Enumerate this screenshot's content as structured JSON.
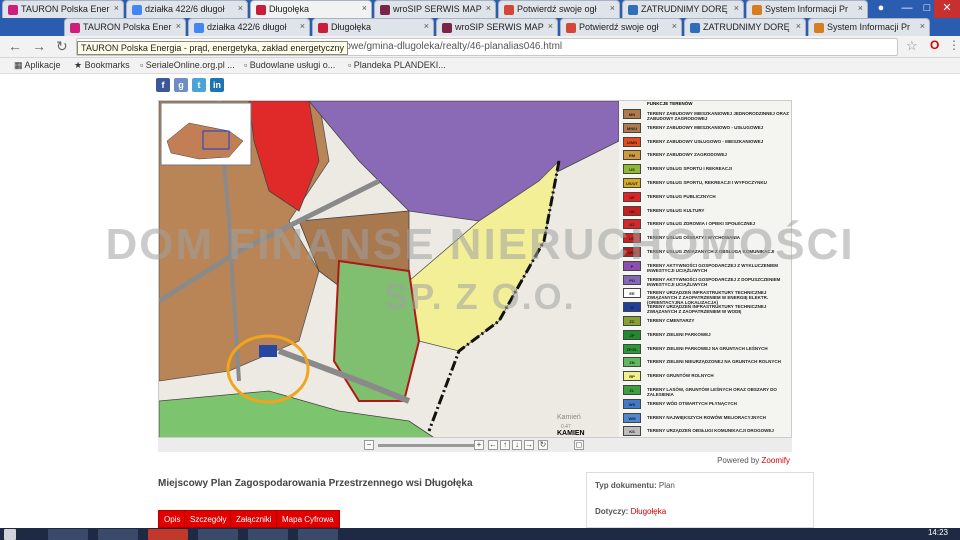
{
  "browser": {
    "tabs": [
      {
        "label": "TAURON Polska Ener",
        "color": "#cc1f7a",
        "active": false
      },
      {
        "label": "TAURON Polska Ener",
        "color": "#cc1f7a",
        "active": false
      },
      {
        "label": "działka 422/6 długoł",
        "color": "#4285f4",
        "active": false
      },
      {
        "label": "działka 422/6 długoł",
        "color": "#4285f4",
        "active": false
      },
      {
        "label": "Długołęka",
        "color": "#c81e3c",
        "active": true
      },
      {
        "label": "Długołęka",
        "color": "#c81e3c",
        "active": false
      },
      {
        "label": "wroSIP SERWIS MAP",
        "color": "#7a2448",
        "active": false
      },
      {
        "label": "wroSIP SERWIS MAP",
        "color": "#7a2448",
        "active": false
      },
      {
        "label": "Potwierdź swoje ogł",
        "color": "#d44638",
        "active": false
      },
      {
        "label": "Potwierdź swoje ogł",
        "color": "#d44638",
        "active": false
      },
      {
        "label": "ZATRUDNIMY DORĘ",
        "color": "#2f6fb7",
        "active": false
      },
      {
        "label": "ZATRUDNIMY DORĘ",
        "color": "#2f6fb7",
        "active": false
      },
      {
        "label": "System Informacji Pr",
        "color": "#d67d1d",
        "active": false
      },
      {
        "label": "System Informacji Pr",
        "color": "#d67d1d",
        "active": false
      }
    ],
    "url": "www.tauron.pl/.../planowanie/plany-miejscowe/gmina-dlugoleka/realty/46-planalias046.html",
    "url_visible": "miejscowe/gmina-dlugoleka/realty/46-planalias046.html",
    "tooltip": "TAURON Polska Energia - prąd, energetyka, zakład energetyczny",
    "bookmarks": [
      {
        "label": "Aplikacje",
        "icon": "apps-grid-icon"
      },
      {
        "label": "Bookmarks",
        "icon": "star-icon"
      },
      {
        "label": "SerialeOnline.org.pl ...",
        "icon": "page-icon"
      },
      {
        "label": "Budowlane usługi o...",
        "icon": "page-icon"
      },
      {
        "label": "Plandeka PLANDEKI...",
        "icon": "a-icon"
      }
    ]
  },
  "page": {
    "social": [
      {
        "name": "facebook",
        "glyph": "f",
        "color": "#3b5998"
      },
      {
        "name": "google",
        "glyph": "g",
        "color": "#6d8ec5"
      },
      {
        "name": "twitter",
        "glyph": "t",
        "color": "#4aa4d6"
      },
      {
        "name": "linkedin",
        "glyph": "in",
        "color": "#1e73b0"
      }
    ],
    "watermark_line1": "DOM FINANSE NIERUCHOMOŚCI",
    "watermark_line2": "SP. Z O.O.",
    "map_labels": {
      "kamien_road": "KAMIEN",
      "kamien_place": "Kamień",
      "kamien_elev": "0.47",
      "compass": "Z"
    },
    "legend_heading": "FUNKCJE TERENÓW",
    "legend": [
      {
        "code": "MN",
        "color": "#b07a4f",
        "text": "TERENY ZABUDOWY MIESZKANIOWEJ JEDNORODZINNEJ ORAZ ZABUDOWY ZAGRODOWEJ"
      },
      {
        "code": "MN/U",
        "color": "#b07a4f",
        "text": "TERENY ZABUDOWY MIESZKANIOWO - USŁUGOWEJ"
      },
      {
        "code": "U/MN",
        "color": "#e64b1e",
        "text": "TERENY ZABUDOWY USŁUGOWO - MIESZKANIOWEJ"
      },
      {
        "code": "RM",
        "color": "#d09a3c",
        "text": "TERENY ZABUDOWY ZAGRODOWEJ"
      },
      {
        "code": "US",
        "color": "#8fb833",
        "text": "TERENY USŁUG SPORTU I REKREACJI"
      },
      {
        "code": "US/UT",
        "color": "#d6a91f",
        "text": "TERENY USŁUG SPORTU, REKREACJI I WYPOCZYNKU"
      },
      {
        "code": "UP",
        "color": "#e02424",
        "text": "TERENY USŁUG PUBLICZNYCH"
      },
      {
        "code": "UK",
        "color": "#c71e1e",
        "text": "TERENY USŁUG KULTURY"
      },
      {
        "code": "UZ",
        "color": "#d22a2a",
        "text": "TERENY USŁUG ZDROWIA I OPIEKI SPOŁECZNEJ"
      },
      {
        "code": "UO",
        "color": "#cc2020",
        "text": "TERENY USŁUG OŚWIATY I WYCHOWANIA"
      },
      {
        "code": "UKS",
        "color": "#b51d1d",
        "text": "TERENY USŁUG ZWIĄZANYCH Z OBSŁUGĄ KOMUNIKACJI"
      },
      {
        "code": "P",
        "color": "#8c4fb0",
        "text": "TERENY AKTYWNOŚCI GOSPODARCZEJ Z WYKLUCZENIEM INWESTYCJI UCIĄŻLIWYCH"
      },
      {
        "code": "PU",
        "color": "#8467b8",
        "text": "TERENY AKTYWNOŚCI GOSPODARCZEJ Z DOPUSZCZENIEM INWESTYCJI UCIĄŻLIWYCH"
      },
      {
        "code": "EE",
        "color": "#ffffff",
        "text": "TERENY URZĄDZEŃ INFRASTRUKTURY TECHNICZNEJ ZWIĄZANYCH Z ZAOPATRZENIEM W ENERGIĘ ELEKTR. (ORIENTACYJNA LOKALIZACJA)"
      },
      {
        "code": "W",
        "color": "#1f3f9a",
        "text": "TERENY URZĄDZEŃ INFRASTRUKTURY TECHNICZNEJ ZWIĄZANYCH Z ZAOPATRZENIEM W WODĘ"
      },
      {
        "code": "ZC",
        "color": "#8aa035",
        "text": "TERENY CMENTARZY"
      },
      {
        "code": "ZP",
        "color": "#1f8a2e",
        "text": "TERENY ZIELENI PARKOWEJ"
      },
      {
        "code": "ZP/ZL",
        "color": "#2a9a35",
        "text": "TERENY ZIELENI PARKOWEJ NA GRUNTACH LEŚNYCH"
      },
      {
        "code": "ZN",
        "color": "#5fba5f",
        "text": "TERENY ZIELENI NIEURZĄDZONEJ NA GRUNTACH ROLNYCH"
      },
      {
        "code": "RP",
        "color": "#f3f08a",
        "text": "TERENY GRUNTÓW ROLNYCH"
      },
      {
        "code": "ZL",
        "color": "#3d9f3d",
        "text": "TERENY LASÓW, GRUNTÓW LEŚNYCH ORAZ OBSZARY DO ZALESIENIA"
      },
      {
        "code": "WS",
        "color": "#3f79c8",
        "text": "TERENY WÓD OTWARTYCH PŁYNĄCYCH"
      },
      {
        "code": "WM",
        "color": "#4f87d0",
        "text": "TERENY NAJWIĘKSZYCH ROWÓW MELIORACYJNYCH"
      },
      {
        "code": "KS",
        "color": "#bdbdbd",
        "text": "TERENY URZĄDZEŃ OBSŁUGI KOMUNIKACJI DROGOWEJ"
      }
    ],
    "powered_prefix": "Powered by",
    "powered_brand": "Zoomify",
    "plan_title": "Miejscowy Plan Zagospodarowania Przestrzennego wsi Długołęka",
    "buttons": [
      "Opis",
      "Szczegóły",
      "Załączniki",
      "Mapa Cyfrowa"
    ],
    "info": {
      "doc_type_label": "Typ dokumentu:",
      "doc_type_value": "Plan",
      "concerns_label": "Dotyczy:",
      "concerns_value": "Długołęka"
    }
  },
  "taskbar": {
    "clock": "14:23"
  }
}
